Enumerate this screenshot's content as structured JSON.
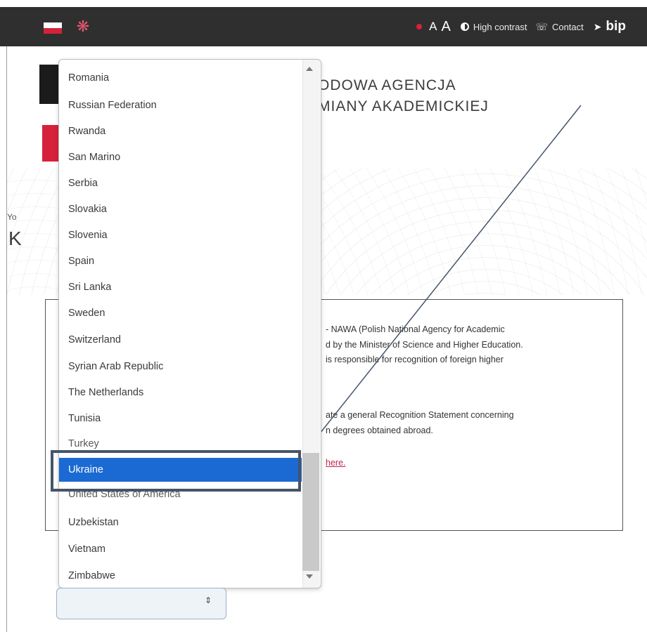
{
  "topbar": {
    "font_small": "A",
    "font_large": "A",
    "high_contrast": "High contrast",
    "contact": "Contact",
    "bip": "bip"
  },
  "header": {
    "agency_line1": "ODOWA AGENCJA",
    "agency_line2": "MIANY AKADEMICKIEJ"
  },
  "hero": {
    "snippet_small": "Yo",
    "snippet_big": "K"
  },
  "content": {
    "lines": [
      "- NAWA (Polish National Agency for Academic",
      "d by the Minister of Science and Higher Education.",
      "is responsible for recognition of foreign higher",
      "ate a general Recognition Statement concerning",
      "n degrees obtained abroad."
    ],
    "link": "here."
  },
  "dropdown": {
    "options": [
      "Romania",
      "Russian Federation",
      "Rwanda",
      "San Marino",
      "Serbia",
      "Slovakia",
      "Slovenia",
      "Spain",
      "Sri Lanka",
      "Sweden",
      "Switzerland",
      "Syrian Arab Republic",
      "The Netherlands",
      "Tunisia",
      "Turkey",
      "Ukraine",
      "United States of America",
      "Uzbekistan",
      "Vietnam",
      "Zimbabwe"
    ],
    "selected": "Ukraine"
  },
  "colors": {
    "topbar_bg": "#2f2f2f",
    "brand_red": "#d6213b",
    "selection_blue": "#1b6ad3",
    "annotation": "#44546a"
  }
}
